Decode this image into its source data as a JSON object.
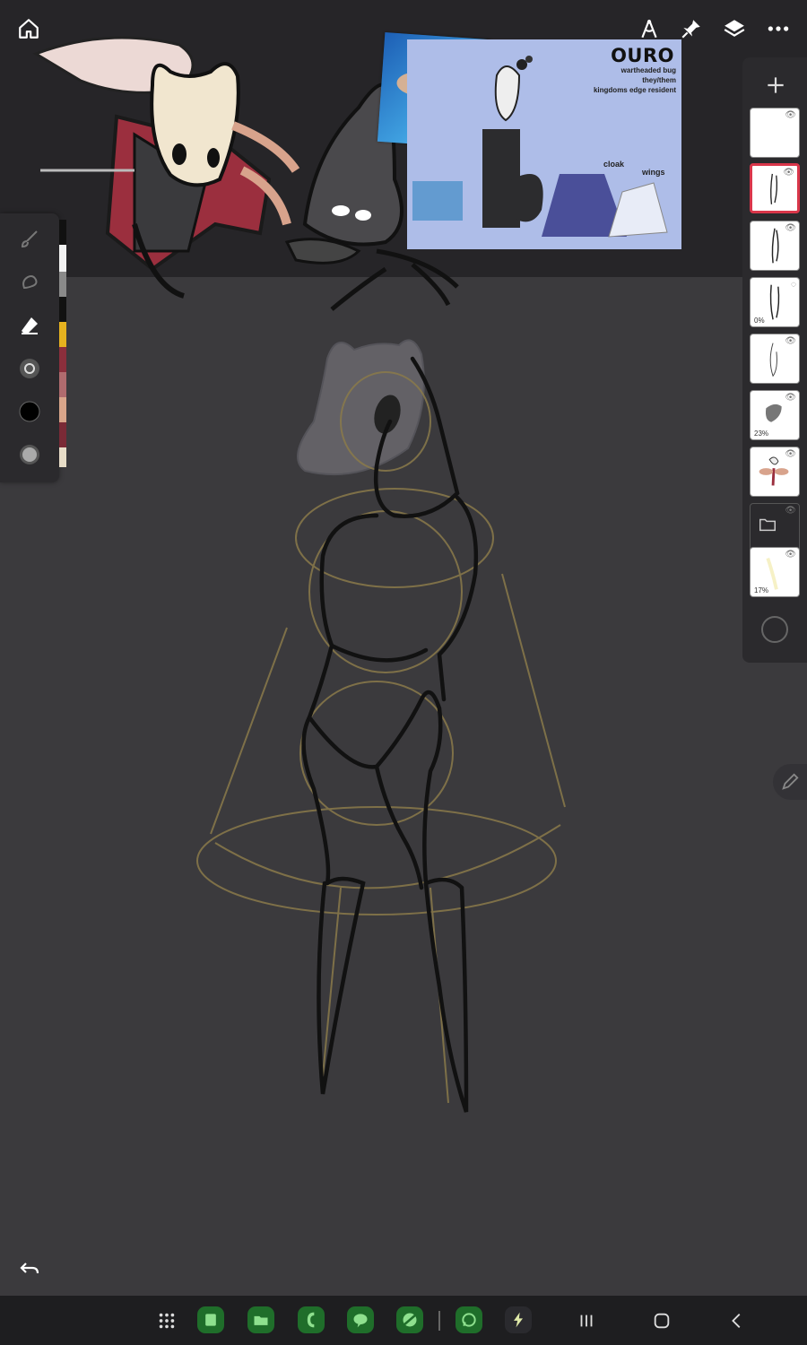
{
  "toolbar": {
    "home_icon": "home-icon",
    "ruler_icon": "compass-icon",
    "pin_icon": "pin-icon",
    "layers_icon": "layers-icon",
    "more_icon": "more-icon"
  },
  "reference": {
    "title": "OURO",
    "line1": "wartheaded bug",
    "line2": "they/them",
    "line3": "kingdoms edge resident",
    "label_cloak": "cloak",
    "label_wings": "wings"
  },
  "tools": [
    "brush-icon",
    "smudge-icon",
    "eraser-icon",
    "brush-size-icon",
    "color-black-icon",
    "opacity-icon"
  ],
  "swatches": [
    "#111111",
    "#f2f2f2",
    "#8a8a8a",
    "#111111",
    "#e6b21f",
    "#8b2f3c",
    "#b06b6e",
    "#d9a58a",
    "#7a2a36",
    "#e8ddc8"
  ],
  "layers": [
    {
      "name": "layer-1",
      "pct": ""
    },
    {
      "name": "layer-2",
      "pct": ""
    },
    {
      "name": "layer-3",
      "pct": ""
    },
    {
      "name": "layer-4",
      "pct": "0%"
    },
    {
      "name": "layer-5",
      "pct": ""
    },
    {
      "name": "layer-6",
      "pct": "23%"
    },
    {
      "name": "layer-7",
      "pct": ""
    },
    {
      "name": "layer-folder",
      "pct": ""
    },
    {
      "name": "layer-9",
      "pct": "17%"
    }
  ],
  "colors": {
    "active_layer_border": "#d9364a",
    "app_green": "#1f6e2a",
    "canvas_bg": "#3b3a3d",
    "bar_bg": "#262528"
  }
}
